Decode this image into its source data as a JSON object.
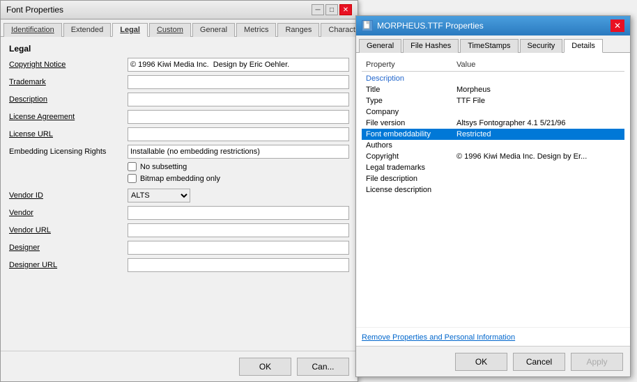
{
  "main_window": {
    "title": "Font Properties",
    "tabs": [
      {
        "label": "Identification",
        "active": false
      },
      {
        "label": "Extended",
        "active": false
      },
      {
        "label": "Legal",
        "active": true
      },
      {
        "label": "Custom",
        "active": false
      },
      {
        "label": "General",
        "active": false
      },
      {
        "label": "Metrics",
        "active": false
      },
      {
        "label": "Ranges",
        "active": false
      },
      {
        "label": "Characteristics",
        "active": false
      }
    ],
    "section_header": "Legal",
    "fields": [
      {
        "label": "Copyright Notice",
        "underline": true,
        "value": "© 1996 Kiwi Media Inc.  Design by Eric Oehler."
      },
      {
        "label": "Trademark",
        "underline": true,
        "value": ""
      },
      {
        "label": "Description",
        "underline": true,
        "value": ""
      },
      {
        "label": "License Agreement",
        "underline": true,
        "value": ""
      },
      {
        "label": "License URL",
        "underline": true,
        "value": ""
      }
    ],
    "embedding": {
      "label": "Embedding Licensing Rights",
      "value": "Installable (no embedding restrictions)"
    },
    "checkboxes": [
      {
        "label": "No subsetting",
        "checked": false
      },
      {
        "label": "Bitmap embedding only",
        "checked": false
      }
    ],
    "vendor_fields": [
      {
        "label": "Vendor ID",
        "type": "dropdown",
        "value": "ALTS",
        "underline": true
      },
      {
        "label": "Vendor",
        "type": "input",
        "value": "",
        "underline": true
      },
      {
        "label": "Vendor URL",
        "type": "input",
        "value": "",
        "underline": true
      },
      {
        "label": "Designer",
        "type": "input",
        "value": "",
        "underline": true
      },
      {
        "label": "Designer URL",
        "type": "input",
        "value": "",
        "underline": true
      }
    ],
    "buttons": {
      "ok": "OK",
      "cancel": "Can..."
    }
  },
  "props_window": {
    "title": "MORPHEUS.TTF Properties",
    "icon": "file-icon",
    "tabs": [
      {
        "label": "General",
        "active": false
      },
      {
        "label": "File Hashes",
        "active": false
      },
      {
        "label": "TimeStamps",
        "active": false
      },
      {
        "label": "Security",
        "active": false
      },
      {
        "label": "Details",
        "active": true
      }
    ],
    "table": {
      "col_property": "Property",
      "col_value": "Value",
      "rows": [
        {
          "type": "section",
          "property": "Description",
          "value": ""
        },
        {
          "type": "data",
          "property": "Title",
          "value": "Morpheus"
        },
        {
          "type": "data",
          "property": "Type",
          "value": "TTF File"
        },
        {
          "type": "data",
          "property": "Company",
          "value": ""
        },
        {
          "type": "data",
          "property": "File version",
          "value": "Altsys Fontographer 4.1 5/21/96"
        },
        {
          "type": "highlight",
          "property": "Font embeddability",
          "value": "Restricted"
        },
        {
          "type": "data",
          "property": "Authors",
          "value": ""
        },
        {
          "type": "data",
          "property": "Copyright",
          "value": "© 1996 Kiwi Media Inc.  Design by Er..."
        },
        {
          "type": "data",
          "property": "Legal trademarks",
          "value": ""
        },
        {
          "type": "data",
          "property": "File description",
          "value": ""
        },
        {
          "type": "data",
          "property": "License description",
          "value": ""
        }
      ]
    },
    "footer_link": "Remove Properties and Personal Information",
    "buttons": {
      "ok": "OK",
      "cancel": "Cancel",
      "apply": "Apply"
    }
  }
}
